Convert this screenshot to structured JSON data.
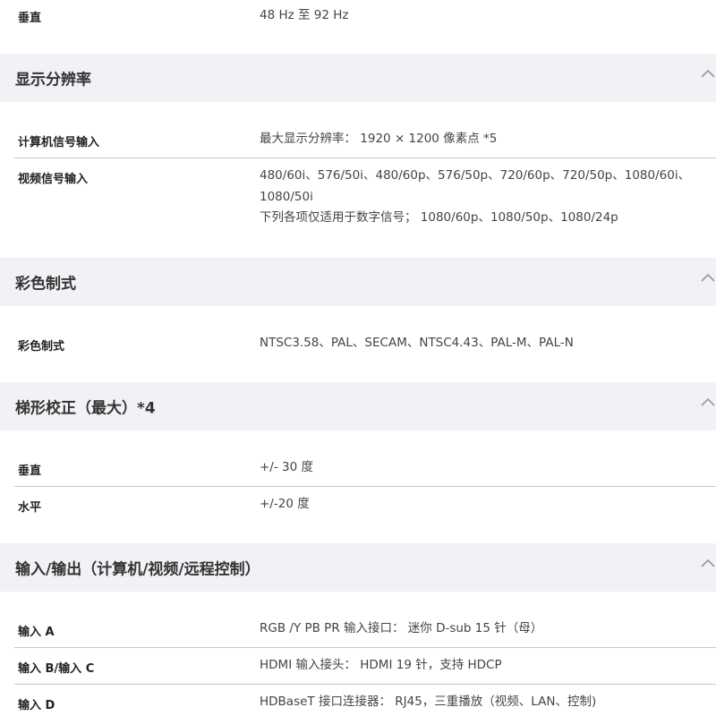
{
  "sections": [
    {
      "id": "top",
      "rows": [
        {
          "label": "垂直",
          "value": [
            "48 Hz 至 92 Hz"
          ]
        }
      ]
    },
    {
      "id": "resolution",
      "title": "显示分辨率",
      "expanded": true,
      "icon": "chevron-up-icon",
      "rows": [
        {
          "label": "计算机信号输入",
          "value": [
            "最大显示分辨率： 1920 × 1200 像素点 *5"
          ]
        },
        {
          "label": "视频信号输入",
          "value": [
            "480/60i、576/50i、480/60p、576/50p、720/60p、720/50p、1080/60i、",
            "1080/50i",
            "下列各项仅适用于数字信号； 1080/60p、1080/50p、1080/24p"
          ]
        }
      ]
    },
    {
      "id": "color-system",
      "title": "彩色制式",
      "expanded": true,
      "icon": "chevron-up-icon",
      "rows": [
        {
          "label": "彩色制式",
          "value": [
            "NTSC3.58、PAL、SECAM、NTSC4.43、PAL-M、PAL-N"
          ]
        }
      ]
    },
    {
      "id": "keystone",
      "title": "梯形校正（最大）*4",
      "expanded": true,
      "icon": "chevron-up-icon",
      "rows": [
        {
          "label": "垂直",
          "value": [
            "+/- 30 度"
          ]
        },
        {
          "label": "水平",
          "value": [
            "+/-20 度"
          ]
        }
      ]
    },
    {
      "id": "io",
      "title": "输入/输出（计算机/视频/远程控制）",
      "expanded": true,
      "icon": "chevron-up-icon",
      "rows": [
        {
          "label": "输入 A",
          "value": [
            "RGB /Y PB PR 输入接口： 迷你 D-sub 15 针（母）"
          ]
        },
        {
          "label": "输入 B/输入 C",
          "value": [
            "HDMI 输入接头： HDMI 19 针，支持 HDCP"
          ]
        },
        {
          "label": "输入 D",
          "value": [
            "HDBaseT 接口连接器： RJ45，三重播放（视频、LAN、控制)"
          ]
        }
      ]
    }
  ],
  "colors": {
    "header_bg": "#f1f2f5",
    "divider": "#c8c8c8",
    "chevron": "#999999"
  }
}
